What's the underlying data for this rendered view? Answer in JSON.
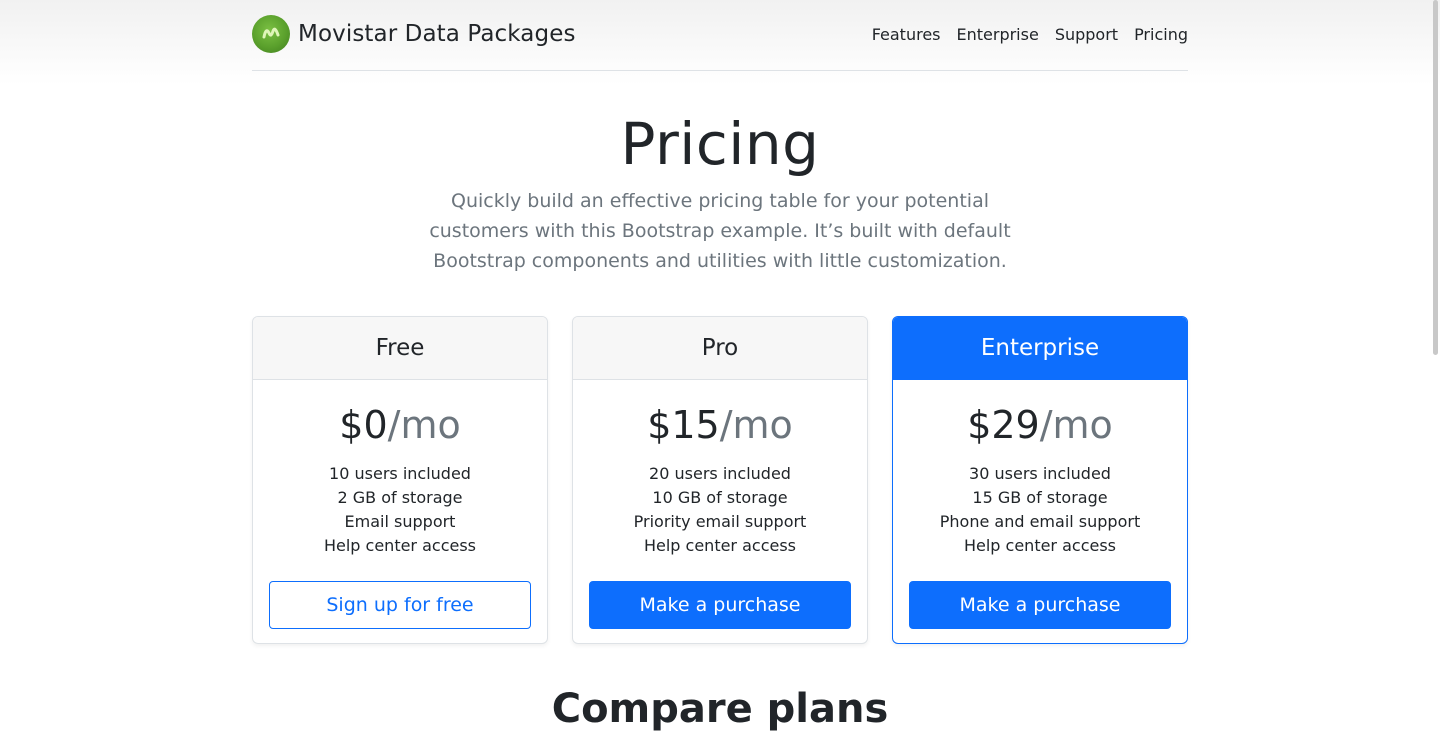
{
  "header": {
    "brand": "Movistar Data Packages",
    "logo_icon": "movistar-logo-icon",
    "nav": [
      "Features",
      "Enterprise",
      "Support",
      "Pricing"
    ]
  },
  "hero": {
    "title": "Pricing",
    "lead": "Quickly build an effective pricing table for your potential customers with this Bootstrap example. It’s built with default Bootstrap components and utilities with little customization."
  },
  "plans": [
    {
      "name": "Free",
      "price": "$0",
      "per": "/mo",
      "features": [
        "10 users included",
        "2 GB of storage",
        "Email support",
        "Help center access"
      ],
      "button": "Sign up for free"
    },
    {
      "name": "Pro",
      "price": "$15",
      "per": "/mo",
      "features": [
        "20 users included",
        "10 GB of storage",
        "Priority email support",
        "Help center access"
      ],
      "button": "Make a purchase"
    },
    {
      "name": "Enterprise",
      "price": "$29",
      "per": "/mo",
      "features": [
        "30 users included",
        "15 GB of storage",
        "Phone and email support",
        "Help center access"
      ],
      "button": "Make a purchase"
    }
  ],
  "compare": {
    "title": "Compare plans"
  },
  "colors": {
    "primary": "#0d6efd",
    "muted": "#6c757d",
    "text": "#212529",
    "logo_green": "#5aa02c"
  }
}
